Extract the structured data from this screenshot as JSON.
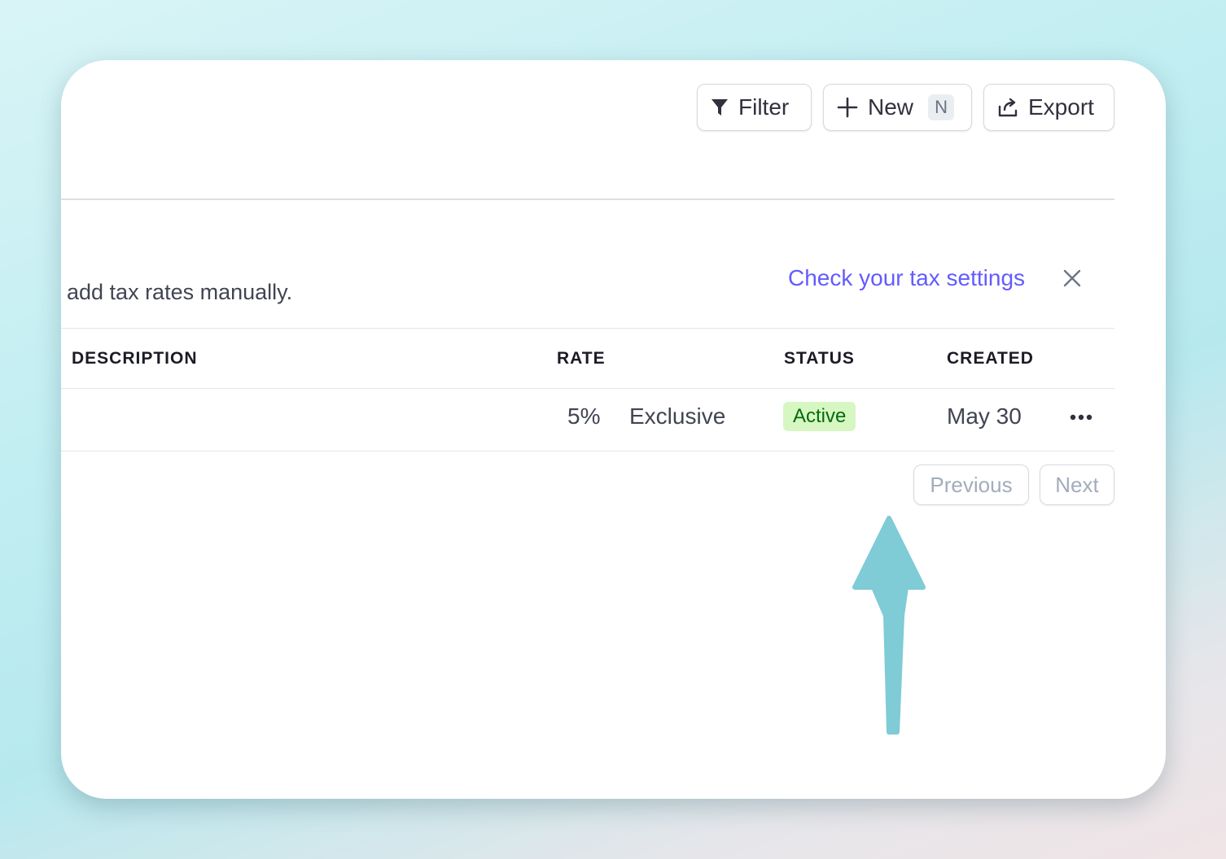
{
  "toolbar": {
    "filter_label": "Filter",
    "new_label": "New",
    "new_shortcut": "N",
    "export_label": "Export"
  },
  "notice": {
    "text": "add tax rates manually.",
    "link_label": "Check your tax settings"
  },
  "table": {
    "headers": {
      "description": "DESCRIPTION",
      "rate": "RATE",
      "status": "STATUS",
      "created": "CREATED"
    },
    "rows": [
      {
        "rate": "5%",
        "type": "Exclusive",
        "status": "Active",
        "created": "May 30"
      }
    ]
  },
  "pagination": {
    "previous_label": "Previous",
    "next_label": "Next"
  },
  "colors": {
    "link": "#635bff",
    "badge_bg": "#d7f7c2",
    "badge_text": "#05690d",
    "annotation_arrow": "#7fcbd6"
  },
  "icons": {
    "filter": "funnel-icon",
    "new": "plus-icon",
    "export": "export-icon",
    "close": "close-icon",
    "more": "more-horizontal-icon"
  }
}
